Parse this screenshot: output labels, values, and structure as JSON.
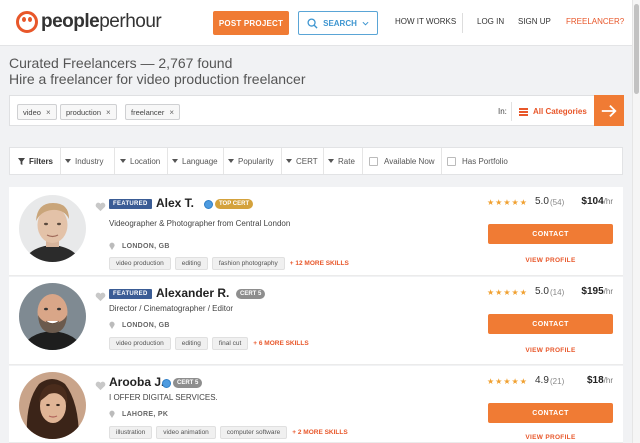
{
  "header": {
    "logo": "peopleperhour",
    "post_project": "POST PROJECT",
    "search": "SEARCH",
    "how_it_works": "HOW IT WORKS",
    "login": "LOG IN",
    "signup": "SIGN UP",
    "freelancer": "FREELANCER?"
  },
  "page": {
    "title_line1": "Curated Freelancers — 2,767 found",
    "title_line2": "Hire a freelancer for video production freelancer"
  },
  "searchbar": {
    "chips": [
      "video",
      "production",
      "freelancer"
    ],
    "in_label": "In:",
    "category": "All Categories"
  },
  "filters": {
    "filters_label": "Filters",
    "industry": "Industry",
    "location": "Location",
    "language": "Language",
    "popularity": "Popularity",
    "cert": "CERT",
    "rate": "Rate",
    "available_now": "Available Now",
    "has_portfolio": "Has Portfolio"
  },
  "freelancers": [
    {
      "featured": "FEATURED",
      "name": "Alex T.",
      "cert": "TOP CERT",
      "tagline": "Videographer & Photographer from Central London",
      "location": "LONDON, GB",
      "skills": [
        "video production",
        "editing",
        "fashion photography"
      ],
      "more_skills": "+ 12 MORE SKILLS",
      "stars": "★★★★★",
      "rating": "5.0",
      "reviews": "(54)",
      "rate": "$104",
      "rate_unit": "/hr",
      "contact": "CONTACT",
      "view_profile": "VIEW PROFILE"
    },
    {
      "featured": "FEATURED",
      "name": "Alexander R.",
      "cert": "CERT 5",
      "tagline": "Director / Cinematographer / Editor",
      "location": "LONDON, GB",
      "skills": [
        "video production",
        "editing",
        "final cut"
      ],
      "more_skills": "+ 6 MORE SKILLS",
      "stars": "★★★★★",
      "rating": "5.0",
      "reviews": "(14)",
      "rate": "$195",
      "rate_unit": "/hr",
      "contact": "CONTACT",
      "view_profile": "VIEW PROFILE"
    },
    {
      "name": "Arooba J.",
      "cert": "CERT 5",
      "tagline": "I OFFER DIGITAL SERVICES.",
      "location": "LAHORE, PK",
      "skills": [
        "illustration",
        "video animation",
        "computer software"
      ],
      "more_skills": "+ 2 MORE SKILLS",
      "stars": "★★★★★",
      "rating": "4.9",
      "reviews": "(21)",
      "rate": "$18",
      "rate_unit": "/hr",
      "contact": "CONTACT",
      "view_profile": "VIEW PROFILE"
    }
  ],
  "colors": {
    "brand_orange": "#f07b34",
    "link_blue": "#3d95d0",
    "featured_blue": "#3a5c95",
    "top_cert": "#d4a23c",
    "cert5": "#8e8e8e"
  }
}
